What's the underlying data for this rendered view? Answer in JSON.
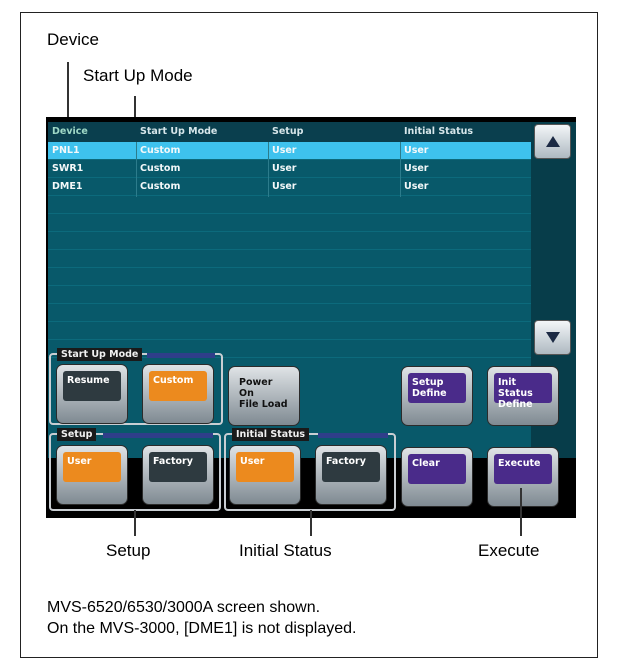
{
  "callouts": {
    "device": "Device",
    "start_up_mode": "Start Up Mode",
    "setup": "Setup",
    "initial_status": "Initial Status",
    "execute": "Execute"
  },
  "table": {
    "headers": [
      "Device",
      "Start Up Mode",
      "Setup",
      "Initial Status"
    ],
    "rows": [
      {
        "device": "PNL1",
        "mode": "Custom",
        "setup": "User",
        "status": "User",
        "selected": true
      },
      {
        "device": "SWR1",
        "mode": "Custom",
        "setup": "User",
        "status": "User",
        "selected": false
      },
      {
        "device": "DME1",
        "mode": "Custom",
        "setup": "User",
        "status": "User",
        "selected": false
      }
    ]
  },
  "scroll": {
    "up_icon": "triangle-up-icon",
    "down_icon": "triangle-down-icon"
  },
  "groups": {
    "start_up_mode": "Start Up Mode",
    "setup": "Setup",
    "initial_status": "Initial Status"
  },
  "buttons": {
    "resume": "Resume",
    "custom": "Custom",
    "power_on_file_load": "Power On\nFile Load",
    "setup_define": "Setup\nDefine",
    "init_status_define": "Init Status\nDefine",
    "setup_user": "User",
    "setup_factory": "Factory",
    "status_user": "User",
    "status_factory": "Factory",
    "clear": "Clear",
    "execute": "Execute"
  },
  "notes": {
    "line1": "MVS-6520/6530/3000A screen shown.",
    "line2": "On the MVS-3000, [DME1] is not displayed."
  },
  "colors": {
    "table_bg": "#08596a",
    "selected_row": "#3ec2ee",
    "selected_button": "#ec8a1e",
    "define_button": "#4a2b8a"
  }
}
